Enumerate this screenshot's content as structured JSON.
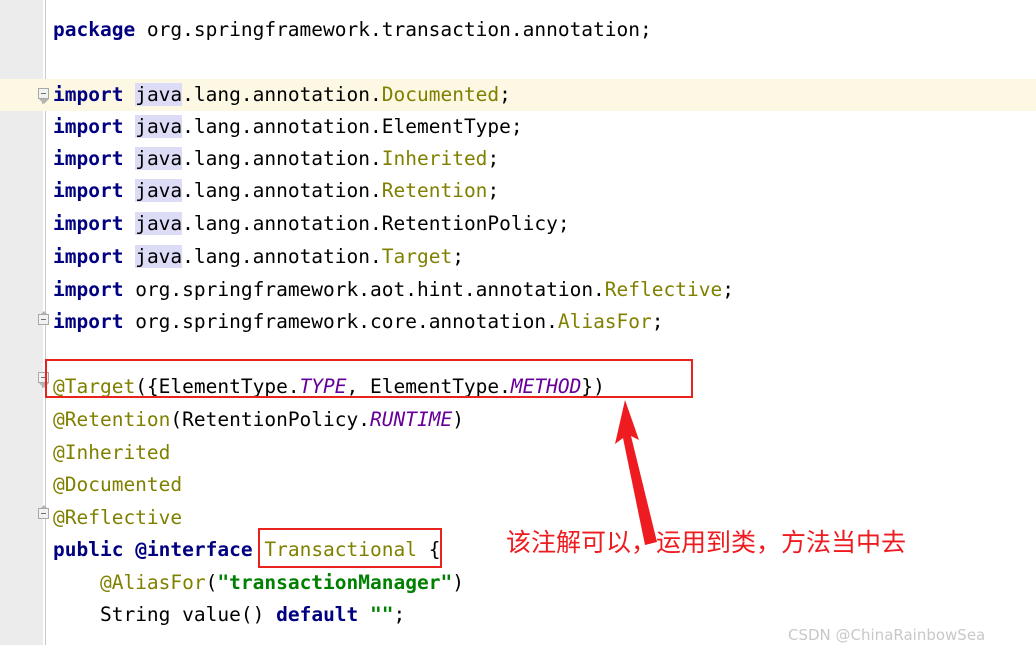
{
  "editor": {
    "language": "java",
    "caret_line_index": 2,
    "highlighted_token": "java",
    "colors": {
      "background": "#ffffff",
      "gutter": "#ececec",
      "caret_line": "#fdf8e3",
      "keyword": "#000080",
      "annotation": "#808000",
      "class_name": "#808000",
      "constant": "#660099",
      "string": "#008000",
      "plain_text": "#000000",
      "occurrence_highlight": "#dcdcf7",
      "markup_red": "#e8231e"
    },
    "lines": [
      {
        "n": 1,
        "text": "package org.springframework.transaction.annotation;"
      },
      {
        "n": 2,
        "text": ""
      },
      {
        "n": 3,
        "text": "import java.lang.annotation.Documented;"
      },
      {
        "n": 4,
        "text": "import java.lang.annotation.ElementType;"
      },
      {
        "n": 5,
        "text": "import java.lang.annotation.Inherited;"
      },
      {
        "n": 6,
        "text": "import java.lang.annotation.Retention;"
      },
      {
        "n": 7,
        "text": "import java.lang.annotation.RetentionPolicy;"
      },
      {
        "n": 8,
        "text": "import java.lang.annotation.Target;"
      },
      {
        "n": 9,
        "text": "import org.springframework.aot.hint.annotation.Reflective;"
      },
      {
        "n": 10,
        "text": "import org.springframework.core.annotation.AliasFor;"
      },
      {
        "n": 11,
        "text": ""
      },
      {
        "n": 12,
        "text": "@Target({ElementType.TYPE, ElementType.METHOD})"
      },
      {
        "n": 13,
        "text": "@Retention(RetentionPolicy.RUNTIME)"
      },
      {
        "n": 14,
        "text": "@Inherited"
      },
      {
        "n": 15,
        "text": "@Documented"
      },
      {
        "n": 16,
        "text": "@Reflective"
      },
      {
        "n": 17,
        "text": "public @interface Transactional {"
      },
      {
        "n": 18,
        "text": "    @AliasFor(\"transactionManager\")"
      },
      {
        "n": 19,
        "text": "    String value() default \"\";"
      }
    ],
    "tokens": {
      "kw_package": "package",
      "kw_import": "import",
      "kw_public": "public",
      "kw_interface": "@interface",
      "kw_default": "default",
      "pkg_java": "java",
      "pkg_lang_annotation": ".lang.annotation.",
      "pkg_org_spring_transaction": " org.springframework.transaction.annotation;",
      "cls_documented": "Documented",
      "cls_element_type": "ElementType",
      "cls_inherited": "Inherited",
      "cls_retention": "Retention",
      "cls_retention_policy": "RetentionPolicy",
      "cls_target": "Target",
      "cls_reflective": "Reflective",
      "cls_alias_for": "AliasFor",
      "cls_transactional": "Transactional",
      "ann_target": "@Target",
      "ann_retention": "@Retention",
      "ann_inherited": "@Inherited",
      "ann_documented": "@Documented",
      "ann_reflective": "@Reflective",
      "ann_alias_for": "@AliasFor",
      "const_type": "TYPE",
      "const_method": "METHOD",
      "const_runtime": "RUNTIME",
      "str_transaction_manager": "\"transactionManager\"",
      "str_empty": "\"\"",
      "type_string": "String",
      "method_value": "value()",
      "semicolon": ";",
      "imp_org_aot": " org.springframework.aot.hint.annotation.",
      "imp_org_core": " org.springframework.core.annotation."
    }
  },
  "markup": {
    "note_text": "该注解可以，运用到类，方法当中去",
    "arrow_color": "#ee1c20",
    "box_target_label": "@Target annotation highlight",
    "box_transactional_label": "Transactional name highlight"
  },
  "watermark": {
    "text": "CSDN @ChinaRainbowSea"
  }
}
